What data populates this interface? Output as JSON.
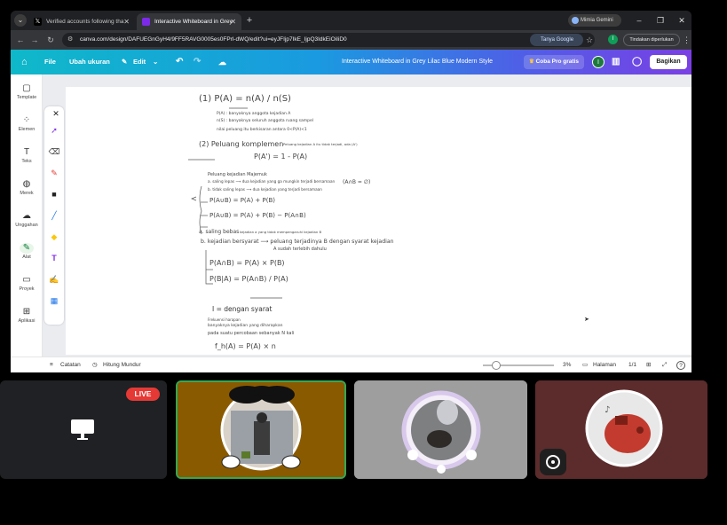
{
  "browser": {
    "tabs": [
      {
        "title": "Verified accounts following tha",
        "favicon": "x-logo-icon"
      },
      {
        "title": "Interactive Whiteboard in Grey",
        "favicon": "canva-icon",
        "active": true
      }
    ],
    "profile_name": "Mimia Gemini",
    "url": "canva.com/design/DAFUEGnGyH4/9FF5RAVG0005es0FPrl-dWQ/edit?ui=eyJFIjp7IkE_IjpQ3IdkEiOiIiD0",
    "tanya_google": "Tanya Google",
    "avatar_letter": "I",
    "paused_label": "Tindakan diperlukan"
  },
  "header": {
    "file": "File",
    "resize": "Ubah ukuran",
    "edit": "Edit",
    "doc_title": "Interactive Whiteboard in Grey Lilac Blue Modern Style",
    "pro": "Coba Pro gratis",
    "avatar_letter": "I",
    "share": "Bagikan"
  },
  "rail": [
    {
      "label": "Template",
      "icon": "template-icon"
    },
    {
      "label": "Elemen",
      "icon": "elements-icon"
    },
    {
      "label": "Teks",
      "icon": "text-icon"
    },
    {
      "label": "Merek",
      "icon": "brand-icon"
    },
    {
      "label": "Unggahan",
      "icon": "upload-icon"
    },
    {
      "label": "Alat",
      "icon": "draw-icon"
    },
    {
      "label": "Proyek",
      "icon": "folder-icon"
    },
    {
      "label": "Aplikasi",
      "icon": "apps-icon"
    }
  ],
  "notes": {
    "l01": "(1)  P(A) = n(A) / n(S)",
    "l02": "P(A)  : banyaknya anggota kejadian A",
    "l03": "n(S)   : banyaknya seluruh anggota ruang sampel",
    "l04": "nilai peluang itu berkisaran antara 0<P(A)<1",
    "l05": "(2)  Peluang komplemen",
    "l06": "Peluang kejadian A itu tidak terjadi, ada (A')",
    "l07": "P(A') = 1 - P(A)",
    "l08": "Peluang kejadian Majemuk",
    "l09": "a. saling lepas  ⟶ dua kejadian yang ga mungkin terjadi bersamaan",
    "l10": "b. tidak saling lepas ⟶ dua kejadian yang terjadi bersamaan",
    "l11": "(A∩B = ∅)",
    "l12": "P(A∪B) = P(A) + P(B)",
    "l13": "P(A∪B) = P(A) + P(B) − P(A∩B)",
    "l14": "a.  saling bebas",
    "l15": "kejadian a yang tidak mempengaruhi kejadian B",
    "l16": "b. kejadian bersyarat ⟶ peluang terjadinya B dengan syarat kejadian",
    "l17": "A sudah terlebih dahulu",
    "l18": "P(A∩B) = P(A) × P(B)",
    "l19": "P(B|A) = P(A∩B) / P(A)",
    "l20": "I = dengan syarat",
    "l21": "Frekuensi harapan",
    "l22": "banyaknya kejadian yang diharapkan",
    "l23": "pada suatu percobaan sebanyak N kali",
    "l24": "f_h(A) = P(A) × n"
  },
  "statusbar": {
    "notes": "Catatan",
    "timer": "Hitung Mundur",
    "zoom": "3%",
    "pages_label": "Halaman",
    "page_count": "1/1",
    "help": "?"
  },
  "meeting": {
    "live": "LIVE"
  },
  "colors": {
    "canva_header_start": "#0fb8c9",
    "canva_header_end": "#7a3fe4",
    "live_red": "#e53935",
    "speaking_green": "#34a853"
  }
}
